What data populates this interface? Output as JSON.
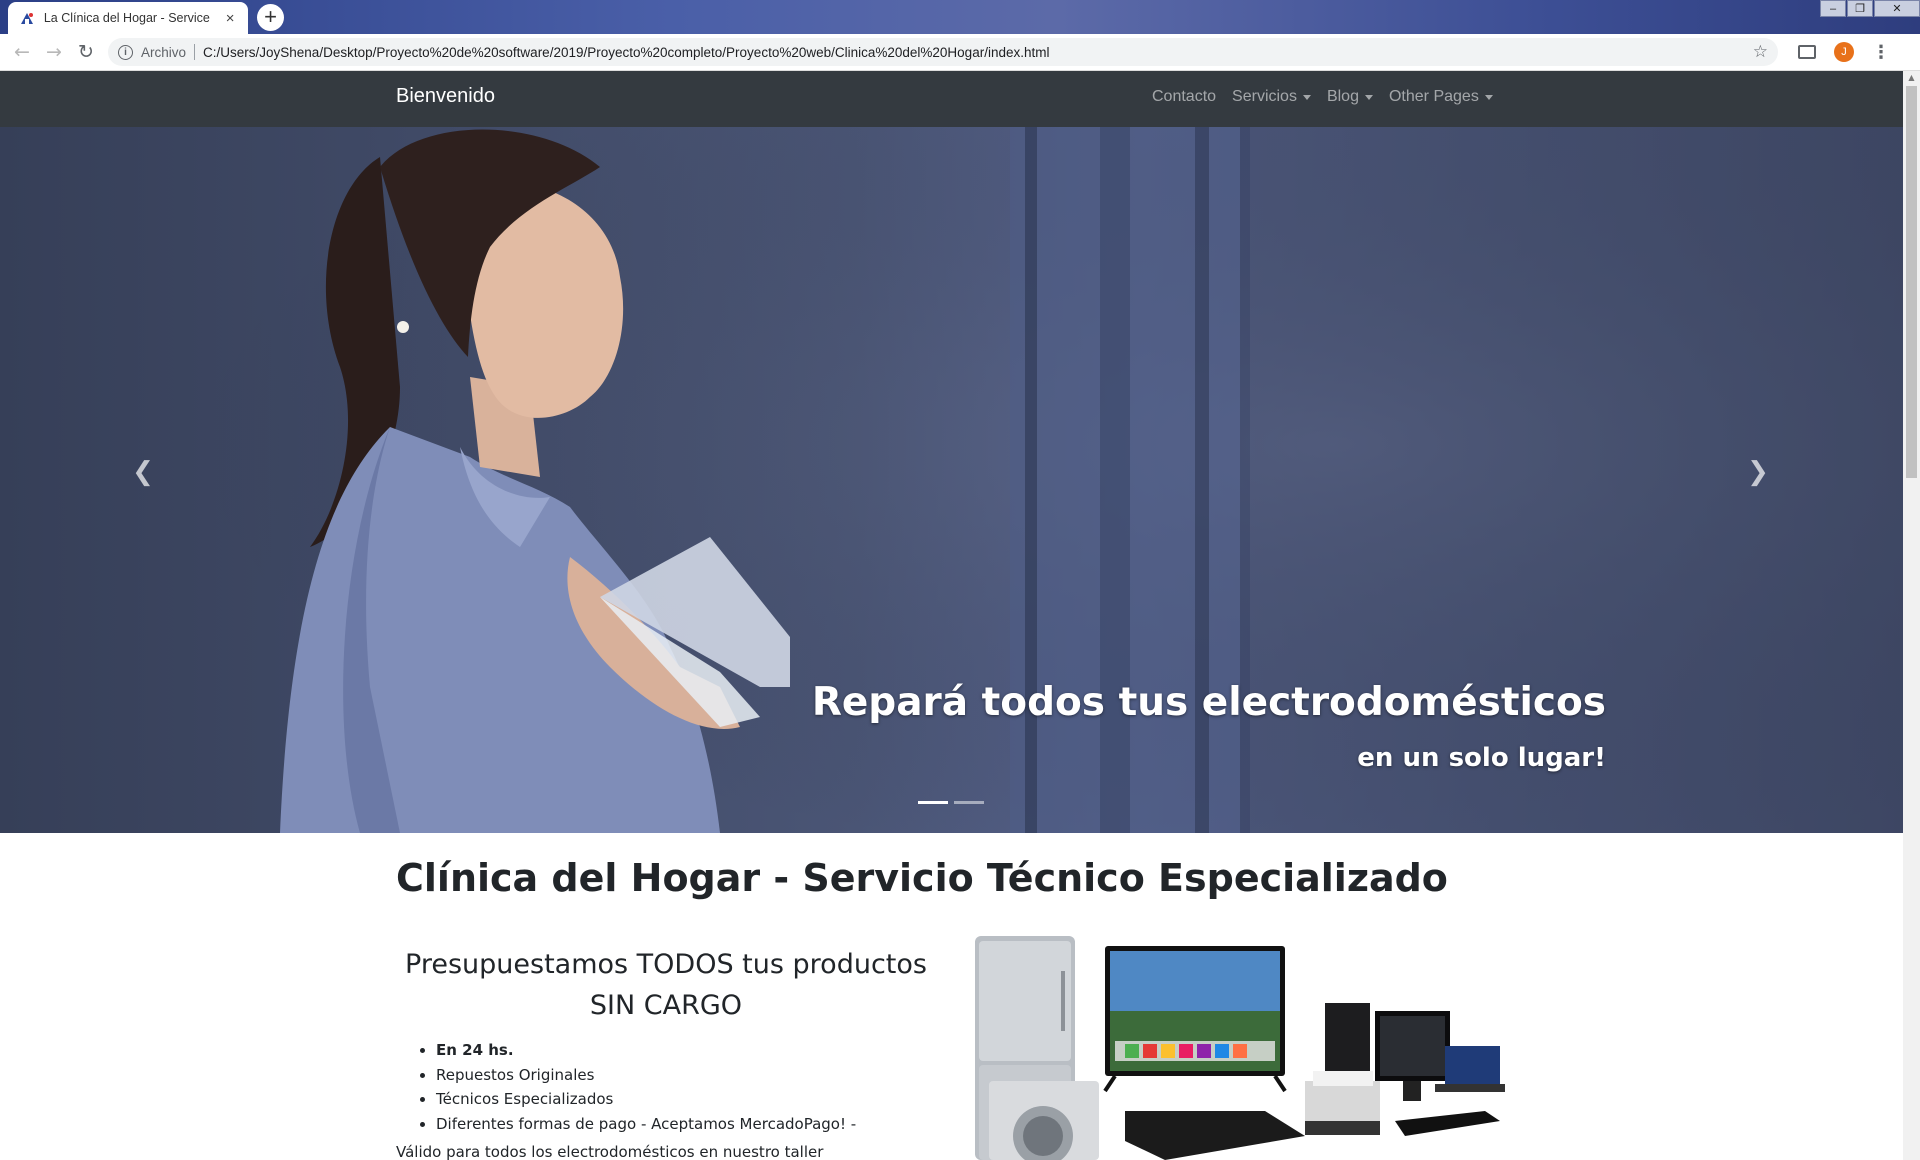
{
  "browser": {
    "tab_title": "La Clínica del Hogar - Service Esp",
    "new_tab_label": "+",
    "tab_close_label": "×",
    "scheme_label": "Archivo",
    "url": "C:/Users/JoyShena/Desktop/Proyecto%20de%20software/2019/Proyecto%20completo/Proyecto%20web/Clinica%20del%20Hogar/index.html",
    "profile_initial": "J",
    "icons": [
      "back-icon",
      "forward-icon",
      "reload-icon",
      "info-icon",
      "star-icon",
      "cast-icon",
      "menu-icon"
    ]
  },
  "site": {
    "brand": "Bienvenido",
    "nav": {
      "contacto": "Contacto",
      "servicios": "Servicios",
      "blog": "Blog",
      "other": "Other Pages"
    },
    "hero": {
      "title": "Repará todos tus electrodomésticos",
      "subtitle": "en un solo lugar!",
      "slide_count": 2,
      "active_slide": 1
    },
    "main_title": "Clínica del Hogar - Servicio Técnico Especializado",
    "headline_line1": "Presupuestamos TODOS tus productos",
    "headline_line2": "SIN CARGO",
    "features": [
      "En 24 hs.",
      "Repuestos Originales",
      "Técnicos Especializados",
      "Diferentes formas de pago - Aceptamos MercadoPago! -"
    ],
    "validity": "Válido para todos los electrodomésticos en nuestro taller",
    "colors": {
      "navbar": "#343a40",
      "text": "#212529"
    }
  }
}
